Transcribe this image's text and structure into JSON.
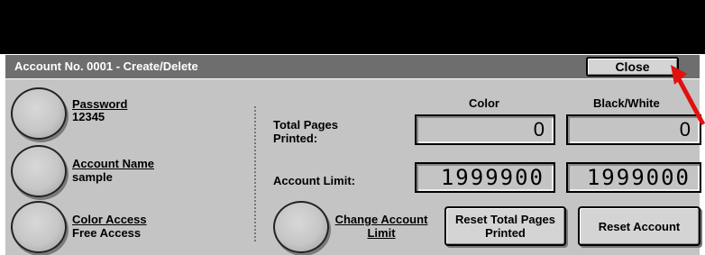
{
  "window": {
    "title": "Account No. 0001 - Create/Delete",
    "close_label": "Close"
  },
  "left": {
    "password": {
      "label": "Password",
      "value": "12345"
    },
    "account_name": {
      "label": "Account Name",
      "value": "sample"
    },
    "color_access": {
      "label": "Color Access",
      "value": "Free Access"
    }
  },
  "counters": {
    "color_header": "Color",
    "bw_header": "Black/White",
    "total_pages_label": "Total Pages Printed:",
    "total_color": "0",
    "total_bw": "0",
    "account_limit_label": "Account Limit:",
    "limit_color": "1999900",
    "limit_bw": "1999000"
  },
  "actions": {
    "change_limit": "Change Account Limit",
    "reset_total": "Reset Total Pages Printed",
    "reset_account": "Reset Account"
  },
  "colors": {
    "panel": "#c4c4c4",
    "title_bar": "#6e6e6e",
    "annotation_arrow": "#e0110f"
  }
}
